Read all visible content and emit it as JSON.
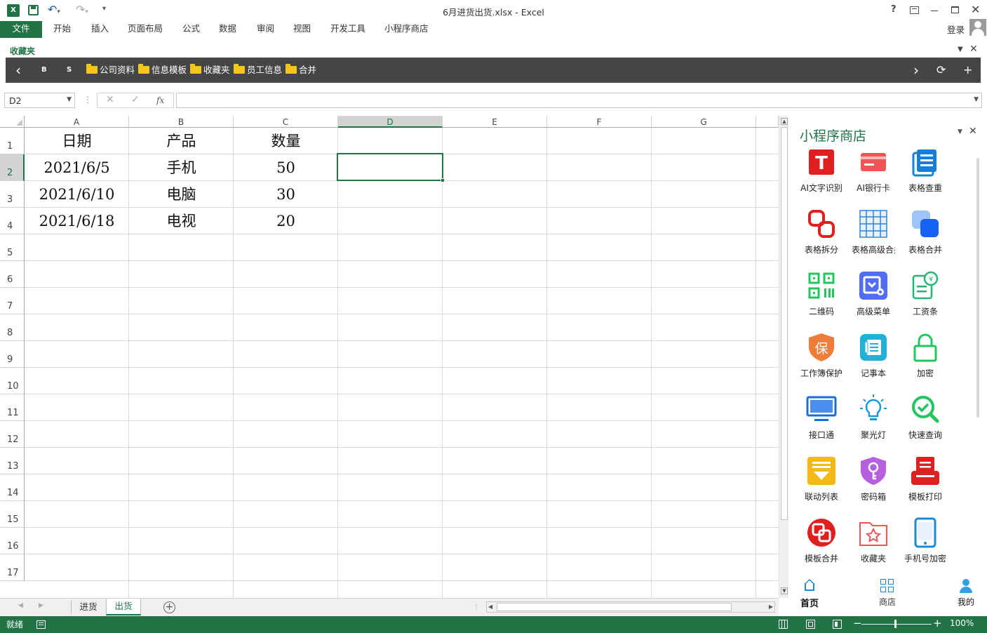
{
  "titlebar": {
    "title": "6月进货出货.xlsx - Excel",
    "help": "?"
  },
  "ribbon": {
    "tabs": [
      "文件",
      "开始",
      "插入",
      "页面布局",
      "公式",
      "数据",
      "审阅",
      "视图",
      "开发工具",
      "小程序商店"
    ],
    "login": "登录"
  },
  "favorites": {
    "label": "收藏夹",
    "nav_prev": "‹",
    "nav_b": "B",
    "nav_s": "S",
    "folders": [
      "公司资料",
      "信息模板",
      "收藏夹",
      "员工信息",
      "合并"
    ],
    "nav_next": "›",
    "refresh": "⟳",
    "add": "+"
  },
  "formula_bar": {
    "name_box": "D2",
    "cancel": "✕",
    "enter": "✓",
    "fx": "fx",
    "formula": ""
  },
  "sheet": {
    "columns": [
      "A",
      "B",
      "C",
      "D",
      "E",
      "F",
      "G"
    ],
    "rows": [
      "1",
      "2",
      "3",
      "4",
      "5",
      "6",
      "7",
      "8",
      "9",
      "10",
      "11",
      "12",
      "13",
      "14",
      "15",
      "16",
      "17"
    ],
    "data": [
      [
        "日期",
        "产品",
        "数量"
      ],
      [
        "2021/6/5",
        "手机",
        "50"
      ],
      [
        "2021/6/10",
        "电脑",
        "30"
      ],
      [
        "2021/6/18",
        "电视",
        "20"
      ]
    ],
    "selected_cell": "D2"
  },
  "sheet_tabs": {
    "tabs": [
      "进货",
      "出货"
    ],
    "active": "出货",
    "add": "+"
  },
  "status": {
    "ready": "就绪",
    "zoom": "100%"
  },
  "panel": {
    "title": "小程序商店",
    "apps": [
      {
        "label": "AI文字识别",
        "icon": "text-recognition-icon",
        "color": "#e02020"
      },
      {
        "label": "AI银行卡",
        "icon": "bank-card-icon",
        "color": "#f05454"
      },
      {
        "label": "表格查重",
        "icon": "document-check-icon",
        "color": "#1a7fd4"
      },
      {
        "label": "表格拆分",
        "icon": "split-icon",
        "color": "#e02020"
      },
      {
        "label": "表格高级合并",
        "icon": "grid-icon",
        "color": "#2f86d8"
      },
      {
        "label": "表格合并",
        "icon": "merge-icon",
        "color": "#1463f5"
      },
      {
        "label": "二维码",
        "icon": "qr-code-icon",
        "color": "#22c55e"
      },
      {
        "label": "高级菜单",
        "icon": "advanced-menu-icon",
        "color": "#4f6df5"
      },
      {
        "label": "工资条",
        "icon": "payslip-icon",
        "color": "#22b573"
      },
      {
        "label": "工作簿保护",
        "icon": "shield-icon",
        "color": "#ee7d3a"
      },
      {
        "label": "记事本",
        "icon": "notepad-icon",
        "color": "#22b0d8"
      },
      {
        "label": "加密",
        "icon": "lock-icon",
        "color": "#22c55e"
      },
      {
        "label": "接口通",
        "icon": "monitor-icon",
        "color": "#1a6fd4"
      },
      {
        "label": "聚光灯",
        "icon": "bulb-icon",
        "color": "#1a9ad4"
      },
      {
        "label": "快速查询",
        "icon": "search-icon",
        "color": "#22c55e"
      },
      {
        "label": "联动列表",
        "icon": "linked-list-icon",
        "color": "#f5b916"
      },
      {
        "label": "密码箱",
        "icon": "key-icon",
        "color": "#b660e0"
      },
      {
        "label": "模板打印",
        "icon": "print-icon",
        "color": "#e02020"
      },
      {
        "label": "模板合并",
        "icon": "template-merge-icon",
        "color": "#e02020"
      },
      {
        "label": "收藏夹",
        "icon": "favorite-folder-icon",
        "color": "#f05454"
      },
      {
        "label": "手机号加密",
        "icon": "phone-icon",
        "color": "#1a8ad4"
      }
    ],
    "nav": [
      {
        "label": "首页",
        "icon": "home-icon"
      },
      {
        "label": "商店",
        "icon": "store-icon"
      },
      {
        "label": "我的",
        "icon": "user-icon"
      }
    ]
  },
  "colors": {
    "accent": "#217346",
    "bookmark_bar": "#444546"
  }
}
